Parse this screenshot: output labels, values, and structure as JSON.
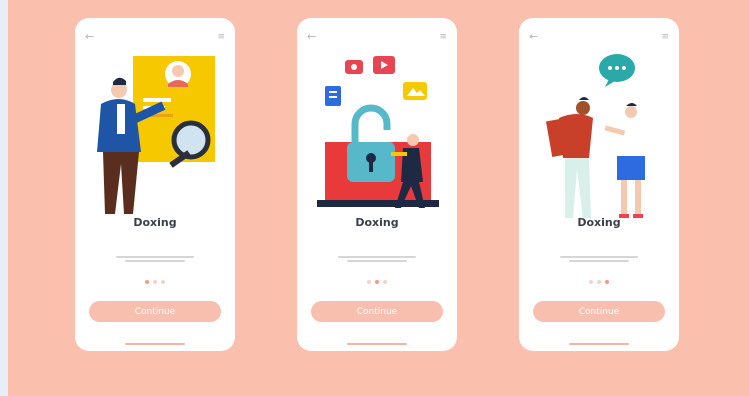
{
  "screens": [
    {
      "title": "Doxing",
      "cta": "Continue",
      "active_dot": 0,
      "illustration": "detective-magnifier-id-card"
    },
    {
      "title": "Doxing",
      "cta": "Continue",
      "active_dot": 1,
      "illustration": "hacker-unlocking-laptop"
    },
    {
      "title": "Doxing",
      "cta": "Continue",
      "active_dot": 2,
      "illustration": "two-people-talking-chat-bubble"
    }
  ],
  "icons": {
    "back": "arrow-left-icon",
    "menu": "menu-icon"
  },
  "colors": {
    "background": "#fbbfae",
    "accent": "#f49a82",
    "button": "#f9bfae",
    "title": "#3b3f4d"
  }
}
